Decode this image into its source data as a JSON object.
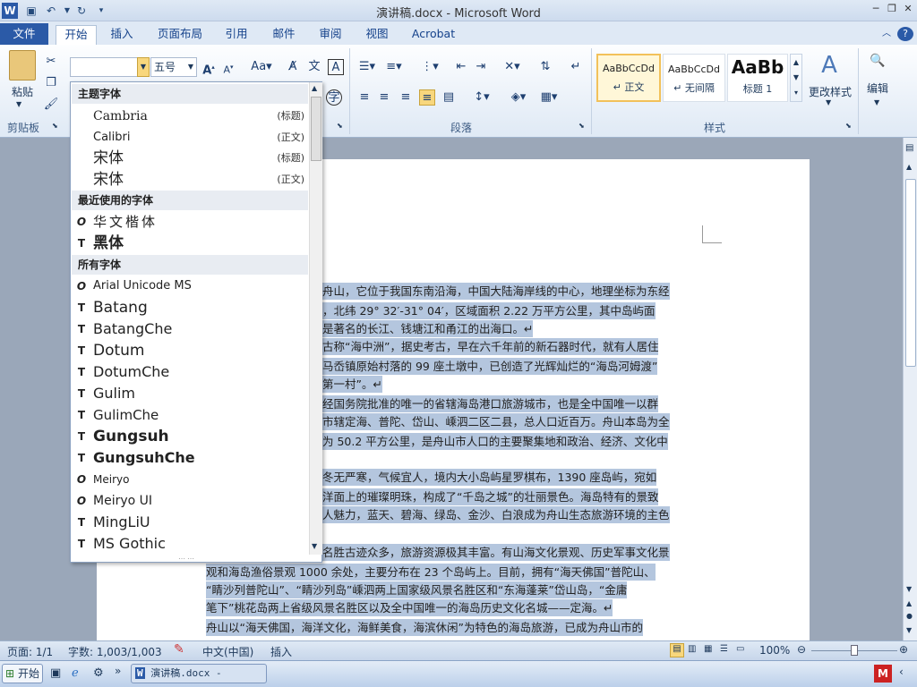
{
  "window": {
    "title": "演讲稿.docx - Microsoft Word"
  },
  "qat": {
    "save": "save-icon",
    "undo": "undo-icon",
    "redo": "redo-icon"
  },
  "tabs": [
    "文件",
    "开始",
    "插入",
    "页面布局",
    "引用",
    "邮件",
    "审阅",
    "视图",
    "Acrobat"
  ],
  "ribbon": {
    "font_name_value": "",
    "font_size": "五号",
    "paste": "粘贴",
    "groups": {
      "clipboard": "剪贴板",
      "paragraph": "段落",
      "styles": "样式"
    },
    "styles": [
      {
        "preview": "AaBbCcDd",
        "label": "↵ 正文"
      },
      {
        "preview": "AaBbCcDd",
        "label": "↵ 无间隔"
      },
      {
        "preview": "AaBb",
        "label": "标题 1"
      }
    ],
    "change_styles": "更改样式",
    "edit": "编辑"
  },
  "font_dropdown": {
    "sections": [
      {
        "title": "主题字体"
      },
      {
        "title": "最近使用的字体"
      },
      {
        "title": "所有字体"
      }
    ],
    "theme": [
      {
        "name": "Cambria",
        "tag": "(标题)"
      },
      {
        "name": "Calibri",
        "tag": "(正文)"
      },
      {
        "name": "宋体",
        "tag": "(标题)"
      },
      {
        "name": "宋体",
        "tag": "(正文)"
      }
    ],
    "recent": [
      {
        "name": "华文楷体",
        "icon": "O"
      },
      {
        "name": "黑体",
        "icon": "T"
      }
    ],
    "all": [
      {
        "name": "Arial Unicode MS",
        "icon": "O"
      },
      {
        "name": "Batang",
        "icon": "T"
      },
      {
        "name": "BatangChe",
        "icon": "T"
      },
      {
        "name": "Dotum",
        "icon": "T"
      },
      {
        "name": "DotumChe",
        "icon": "T"
      },
      {
        "name": "Gulim",
        "icon": "T"
      },
      {
        "name": "GulimChe",
        "icon": "T"
      },
      {
        "name": "Gungsuh",
        "icon": "T"
      },
      {
        "name": "GungsuhChe",
        "icon": "T"
      },
      {
        "name": "Meiryo",
        "icon": "O"
      },
      {
        "name": "Meiryo UI",
        "icon": "O"
      },
      {
        "name": "MingLiU",
        "icon": "T"
      },
      {
        "name": "MS Gothic",
        "icon": "T"
      }
    ]
  },
  "document": {
    "lines": [
      "舟山，它位于我国东南沿海，中国大陆海岸线的中心，地理坐标为东经",
      "，北纬 29° 32′-31° 04′，区域面积 2.22 万平方公里，其中岛屿面",
      "是著名的长江、钱塘江和甬江的出海口。↵",
      "古称“海中洲”，据史考古，早在六千年前的新石器时代，就有人居住",
      "马岙镇原始村落的 99 座土墩中，已创造了光辉灿烂的“海岛河姆渡”",
      "第一村”。↵",
      "经国务院批准的唯一的省辖海岛港口旅游城市，也是全中国唯一以群",
      "市辖定海、普陀、岱山、嵊泗二区二县，总人口近百万。舟山本岛为全",
      "为 50.2 平方公里，是舟山市人口的主要聚集地和政治、经济、文化中",
      "",
      "冬无严寒，气候宜人，境内大小岛屿星罗棋布，1390 座岛屿，宛如",
      "洋面上的璀璨明珠，构成了“千岛之城”的壮丽景色。海岛特有的景致",
      "人魅力，蓝天、碧海、绿岛、金沙、白浪成为舟山生态旅游环境的主色",
      "",
      "名胜古迹众多，旅游资源极其丰富。有山海文化景观、历史军事文化景",
      "观和海岛渔俗景观 1000 余处，主要分布在 23 个岛屿上。目前，拥有“海天佛国”普陀山、",
      "“睛沙列普陀山”、“睛沙列岛”嵊泗两上国家级风景名胜区和“东海蓬莱”岱山岛，“金庸",
      "笔下”桃花岛两上省级风景名胜区以及全中国唯一的海岛历史文化名城——定海。↵",
      "舟山以“海天佛国，海洋文化，海鲜美食，海滨休闲”为特色的海岛旅游，已成为舟山市的"
    ]
  },
  "statusbar": {
    "page": "页面: 1/1",
    "words": "字数: 1,003/1,003",
    "language": "中文(中国)",
    "mode": "插入",
    "zoom": "100%"
  },
  "taskbar": {
    "start": "开始",
    "app": "演讲稿.docx - Micro..."
  }
}
